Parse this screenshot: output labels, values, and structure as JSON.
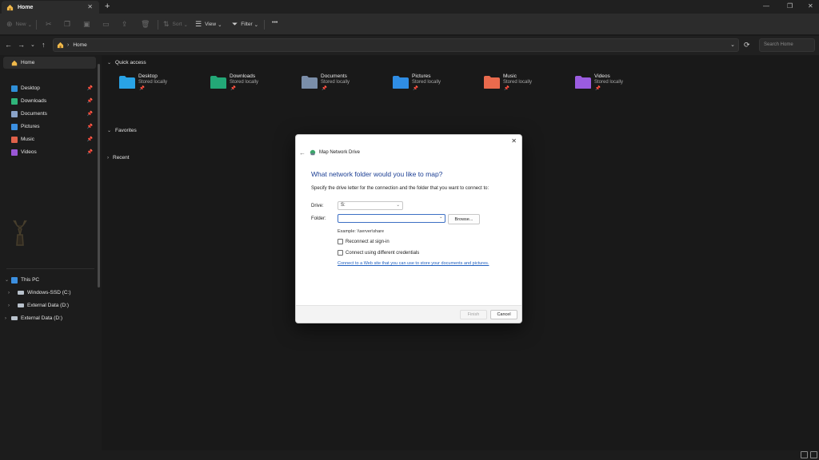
{
  "tab": {
    "title": "Home",
    "close": "✕"
  },
  "new_tab": "+",
  "window_controls": [
    "—",
    "❐",
    "✕"
  ],
  "commands": {
    "new": "New",
    "sort": "Sort",
    "view": "View",
    "filter": "Filter",
    "more": "•••"
  },
  "address": {
    "crumb": "Home",
    "search_placeholder": "Search Home"
  },
  "sidebar": {
    "home": "Home",
    "pinned": [
      {
        "label": "Desktop",
        "color": "#2f8fd8"
      },
      {
        "label": "Downloads",
        "color": "#2fb57a"
      },
      {
        "label": "Documents",
        "color": "#8aa3c8"
      },
      {
        "label": "Pictures",
        "color": "#3b8fe0"
      },
      {
        "label": "Music",
        "color": "#e0614a"
      },
      {
        "label": "Videos",
        "color": "#9a57d6"
      }
    ],
    "this_pc": "This PC",
    "drives": [
      "Windows-SSD (C:)",
      "External Data (D:)"
    ],
    "external": "External Data (D:)"
  },
  "main": {
    "quick_access": "Quick access",
    "favorites": "Favorites",
    "recent": "Recent",
    "quick_items": [
      {
        "name": "Desktop",
        "sub": "Stored locally",
        "color": "#29a3e6"
      },
      {
        "name": "Downloads",
        "sub": "Stored locally",
        "color": "#23a877"
      },
      {
        "name": "Documents",
        "sub": "Stored locally",
        "color": "#7b8ea9"
      },
      {
        "name": "Pictures",
        "sub": "Stored locally",
        "color": "#2f8de4"
      },
      {
        "name": "Music",
        "sub": "Stored locally",
        "color": "#e86a4d"
      },
      {
        "name": "Videos",
        "sub": "Stored locally",
        "color": "#9b5ce0"
      }
    ]
  },
  "dialog": {
    "title": "Map Network Drive",
    "heading": "What network folder would you like to map?",
    "description": "Specify the drive letter for the connection and the folder that you want to connect to:",
    "drive_label": "Drive:",
    "drive_value": "S:",
    "folder_label": "Folder:",
    "folder_value": "",
    "browse": "Browse...",
    "example": "Example: \\\\server\\share",
    "reconnect": "Reconnect at sign-in",
    "different_credentials": "Connect using different credentials",
    "link": "Connect to a Web site that you can use to store your documents and pictures.",
    "finish": "Finish",
    "cancel": "Cancel"
  }
}
